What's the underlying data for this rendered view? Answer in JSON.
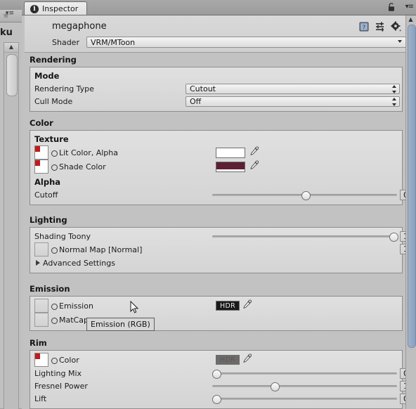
{
  "window": {
    "tab_label": "Inspector",
    "tab_icon": "info-circle-icon",
    "lock_icon": "lock-icon",
    "menu_icon": "hamburger-menu-icon"
  },
  "left_panel": {
    "star_icon": "favorite-star-icon",
    "cut_text": "ku",
    "menu_icon": "hamburger-menu-icon",
    "scroll_up_glyph": "▲"
  },
  "material": {
    "name": "megaphone",
    "shader_label": "Shader",
    "shader_value": "VRM/MToon",
    "header_icons": [
      "help-book-icon",
      "preset-icon",
      "gear-icon"
    ]
  },
  "sections": {
    "rendering": {
      "title": "Rendering",
      "sub_title": "Mode",
      "rows": [
        {
          "label": "Rendering Type",
          "value": "Cutout"
        },
        {
          "label": "Cull Mode",
          "value": "Off"
        }
      ]
    },
    "color": {
      "title": "Color",
      "texture_title": "Texture",
      "textures": [
        {
          "label": "Lit Color, Alpha",
          "swatch": "#ffffff",
          "has_alpha_bar": false
        },
        {
          "label": "Shade Color",
          "swatch": "#5c1f33",
          "has_alpha_bar": true
        }
      ],
      "alpha_title": "Alpha",
      "cutoff": {
        "label": "Cutoff",
        "value": "0.5",
        "percent": 50
      }
    },
    "lighting": {
      "title": "Lighting",
      "shading_toony": {
        "label": "Shading Toony",
        "value": "1",
        "percent": 100
      },
      "normal_map": {
        "label": "Normal Map [Normal]",
        "value": "1"
      },
      "advanced": "Advanced Settings"
    },
    "emission": {
      "title": "Emission",
      "rows": [
        {
          "label": "Emission",
          "badge": "HDR"
        },
        {
          "label": "MatCap",
          "badge": ""
        }
      ]
    },
    "rim": {
      "title": "Rim",
      "color_row": {
        "label": "Color",
        "swatch": "#6d6a6a",
        "badge": "HDR"
      },
      "sliders": [
        {
          "label": "Lighting Mix",
          "value": "0",
          "percent": 0
        },
        {
          "label": "Fresnel Power",
          "value": "1",
          "percent": 25
        },
        {
          "label": "Lift",
          "value": "0",
          "percent": 0
        }
      ]
    }
  },
  "tooltip": {
    "text": "Emission (RGB)"
  },
  "colors": {
    "panel_bg": "#c2c2c2",
    "box_bg": "#dadada",
    "accent_scroll": "#93a8c4",
    "texture_corner": "#c01c1c"
  }
}
